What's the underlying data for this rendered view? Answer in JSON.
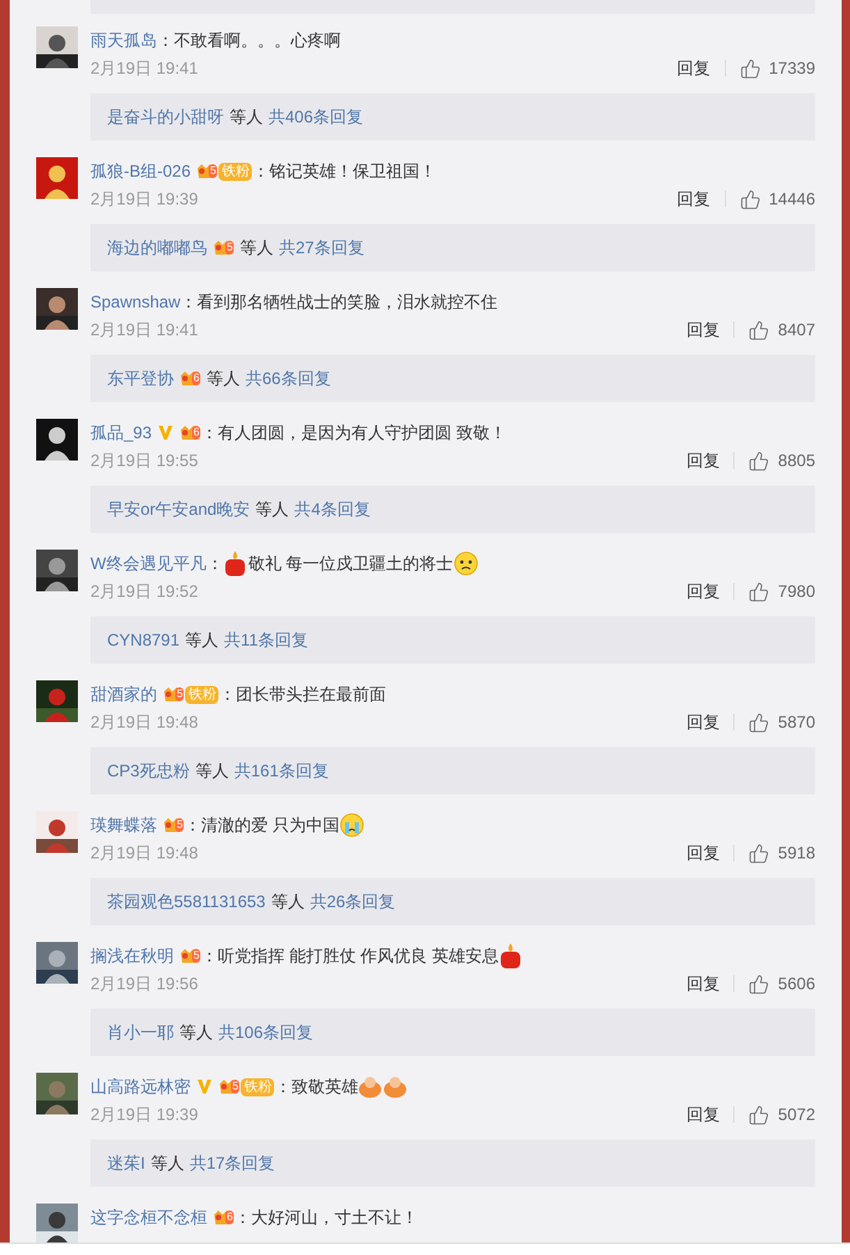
{
  "comments": [
    {
      "user": "雨天孤岛",
      "verified": false,
      "content": [
        {
          "kind": "text",
          "text": "：不敢看啊。。。心疼啊"
        }
      ],
      "time": "2月19日 19:41",
      "reply_label": "回复",
      "likes": "17339",
      "replies": {
        "user": "是奋斗的小甜呀",
        "suffix": "等人",
        "count": "共406条回复"
      }
    },
    {
      "user": "孤狼-B组-026",
      "verified": false,
      "fan_badge": {
        "level": "5",
        "label": "铁粉"
      },
      "content": [
        {
          "kind": "text",
          "text": "：铭记英雄！保卫祖国！"
        }
      ],
      "time": "2月19日 19:39",
      "reply_label": "回复",
      "likes": "14446",
      "replies": {
        "user": "海边的嘟嘟鸟",
        "user_badge": {
          "level": "5"
        },
        "suffix": "等人",
        "count": "共27条回复"
      }
    },
    {
      "user": "Spawnshaw",
      "verified": false,
      "content": [
        {
          "kind": "text",
          "text": "：看到那名牺牲战士的笑脸，泪水就控不住"
        }
      ],
      "time": "2月19日 19:41",
      "reply_label": "回复",
      "likes": "8407",
      "replies": {
        "user": "东平登协",
        "user_badge": {
          "level": "6"
        },
        "suffix": "等人",
        "count": "共66条回复"
      }
    },
    {
      "user": "孤品_93",
      "verified": true,
      "fan_badge": {
        "level": "6"
      },
      "content": [
        {
          "kind": "text",
          "text": "：有人团圆，是因为有人守护团圆 致敬！"
        }
      ],
      "time": "2月19日 19:55",
      "reply_label": "回复",
      "likes": "8805",
      "replies": {
        "user": "早安or午安and晚安",
        "suffix": "等人",
        "count": "共4条回复"
      }
    },
    {
      "user": "W终会遇见平凡",
      "verified": false,
      "content": [
        {
          "kind": "text",
          "text": "："
        },
        {
          "kind": "candle"
        },
        {
          "kind": "text",
          "text": "敬礼 每一位戍卫疆土的将士"
        },
        {
          "kind": "sad"
        }
      ],
      "time": "2月19日 19:52",
      "reply_label": "回复",
      "likes": "7980",
      "replies": {
        "user": "CYN8791",
        "suffix": "等人",
        "count": "共11条回复"
      }
    },
    {
      "user": "甜酒家的",
      "verified": false,
      "fan_badge": {
        "level": "5",
        "label": "铁粉"
      },
      "content": [
        {
          "kind": "text",
          "text": "：团长带头拦在最前面"
        }
      ],
      "time": "2月19日 19:48",
      "reply_label": "回复",
      "likes": "5870",
      "replies": {
        "user": "CP3死忠粉",
        "suffix": "等人",
        "count": "共161条回复"
      }
    },
    {
      "user": "瑛舞蝶落",
      "verified": false,
      "fan_badge": {
        "level": "5"
      },
      "content": [
        {
          "kind": "text",
          "text": "：清澈的爱 只为中国"
        },
        {
          "kind": "crying"
        }
      ],
      "time": "2月19日 19:48",
      "reply_label": "回复",
      "likes": "5918",
      "replies": {
        "user": "茶园观色5581131653",
        "suffix": "等人",
        "count": "共26条回复"
      }
    },
    {
      "user": "搁浅在秋明",
      "verified": false,
      "fan_badge": {
        "level": "5"
      },
      "content": [
        {
          "kind": "text",
          "text": "：听党指挥 能打胜仗 作风优良 英雄安息"
        },
        {
          "kind": "candle"
        }
      ],
      "time": "2月19日 19:56",
      "reply_label": "回复",
      "likes": "5606",
      "replies": {
        "user": "肖小一耶",
        "suffix": "等人",
        "count": "共106条回复"
      }
    },
    {
      "user": "山高路远林密",
      "verified": true,
      "fan_badge": {
        "level": "5",
        "label": "铁粉"
      },
      "content": [
        {
          "kind": "text",
          "text": "：致敬英雄"
        },
        {
          "kind": "salute"
        },
        {
          "kind": "salute"
        }
      ],
      "time": "2月19日 19:39",
      "reply_label": "回复",
      "likes": "5072",
      "replies": {
        "user": "迷茱I",
        "suffix": "等人",
        "count": "共17条回复"
      }
    },
    {
      "user": "这字念桓不念桓",
      "verified": false,
      "fan_badge": {
        "level": "6"
      },
      "content": [
        {
          "kind": "text",
          "text": "：大好河山，寸土不让！"
        }
      ]
    }
  ]
}
